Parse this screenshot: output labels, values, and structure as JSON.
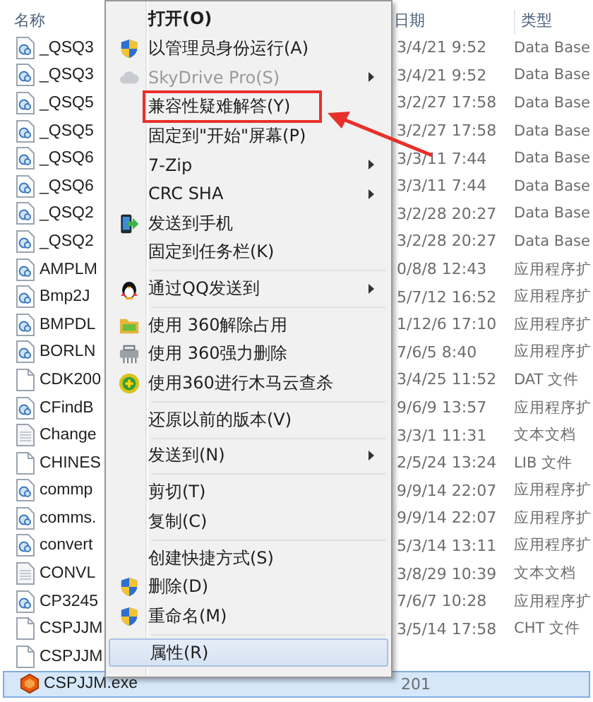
{
  "file_list": {
    "columns": [
      "名称",
      "日期",
      "类型"
    ],
    "rows": [
      {
        "name": "_QSQ3",
        "kind": "dll",
        "date": "3/4/21 9:52",
        "type": "Data Base",
        "selected": false
      },
      {
        "name": "_QSQ3",
        "kind": "dll",
        "date": "3/4/21 9:52",
        "type": "Data Base",
        "selected": false
      },
      {
        "name": "_QSQ5",
        "kind": "dll",
        "date": "3/2/27 17:58",
        "type": "Data Base",
        "selected": false
      },
      {
        "name": "_QSQ5",
        "kind": "dll",
        "date": "3/2/27 17:58",
        "type": "Data Base",
        "selected": false
      },
      {
        "name": "_QSQ6",
        "kind": "dll",
        "date": "3/3/11 7:44",
        "type": "Data Base",
        "selected": false
      },
      {
        "name": "_QSQ6",
        "kind": "dll",
        "date": "3/3/11 7:44",
        "type": "Data Base",
        "selected": false
      },
      {
        "name": "_QSQ2",
        "kind": "dll",
        "date": "3/2/28 20:27",
        "type": "Data Base",
        "selected": false
      },
      {
        "name": "_QSQ2",
        "kind": "dll",
        "date": "3/2/28 20:27",
        "type": "Data Base",
        "selected": false
      },
      {
        "name": "AMPLM",
        "kind": "dll",
        "date": "0/8/8 12:43",
        "type": "应用程序扩",
        "selected": false
      },
      {
        "name": "Bmp2J",
        "kind": "dll",
        "date": "5/7/12 16:52",
        "type": "应用程序扩",
        "selected": false
      },
      {
        "name": "BMPDL",
        "kind": "dll",
        "date": "1/12/6 17:10",
        "type": "应用程序扩",
        "selected": false
      },
      {
        "name": "BORLN",
        "kind": "dll",
        "date": "7/6/5 8:40",
        "type": "应用程序扩",
        "selected": false
      },
      {
        "name": "CDK200",
        "kind": "file",
        "date": "3/4/25 11:52",
        "type": "DAT 文件",
        "selected": false
      },
      {
        "name": "CFindB",
        "kind": "dll",
        "date": "9/6/9 13:57",
        "type": "应用程序扩",
        "selected": false
      },
      {
        "name": "Change",
        "kind": "text",
        "date": "3/3/1 11:31",
        "type": "文本文档",
        "selected": false
      },
      {
        "name": "CHINES",
        "kind": "file",
        "date": "2/5/24 13:24",
        "type": "LIB 文件",
        "selected": false
      },
      {
        "name": "commp",
        "kind": "dll",
        "date": "9/9/14 22:07",
        "type": "应用程序扩",
        "selected": false
      },
      {
        "name": "comms.",
        "kind": "dll",
        "date": "9/9/14 22:07",
        "type": "应用程序扩",
        "selected": false
      },
      {
        "name": "convert",
        "kind": "dll",
        "date": "5/3/14 13:11",
        "type": "应用程序扩",
        "selected": false
      },
      {
        "name": "CONVL",
        "kind": "text",
        "date": "3/8/29 10:39",
        "type": "文本文档",
        "selected": false
      },
      {
        "name": "CP3245",
        "kind": "dll",
        "date": "7/6/7 10:28",
        "type": "应用程序扩",
        "selected": false
      },
      {
        "name": "CSPJJM",
        "kind": "file",
        "date": "3/5/14 17:58",
        "type": "CHT 文件",
        "selected": false
      },
      {
        "name": "CSPJJM",
        "kind": "file",
        "selected": false
      },
      {
        "name": "CSPJJM.exe",
        "kind": "exe",
        "date": "201",
        "selected": true
      }
    ]
  },
  "context_menu": {
    "items": [
      {
        "kind": "plain",
        "label": "打开(O)",
        "bold": true,
        "submenu": false,
        "disabled": false,
        "selected": false,
        "annotated": false
      },
      {
        "kind": "shield",
        "label": "以管理员身份运行(A)",
        "bold": false,
        "submenu": false,
        "disabled": false,
        "selected": false,
        "annotated": false
      },
      {
        "kind": "cloud",
        "label": "SkyDrive Pro(S)",
        "bold": false,
        "submenu": true,
        "disabled": true,
        "selected": false,
        "annotated": false
      },
      {
        "kind": "plain",
        "label": "兼容性疑难解答(Y)",
        "bold": false,
        "submenu": false,
        "disabled": false,
        "selected": false,
        "annotated": true
      },
      {
        "kind": "plain",
        "label": "固定到\"开始\"屏幕(P)",
        "bold": false,
        "submenu": false,
        "disabled": false,
        "selected": false,
        "annotated": false
      },
      {
        "kind": "plain",
        "label": "7-Zip",
        "bold": false,
        "submenu": true,
        "disabled": false,
        "selected": false,
        "annotated": false
      },
      {
        "kind": "plain",
        "label": "CRC SHA",
        "bold": false,
        "submenu": true,
        "disabled": false,
        "selected": false,
        "annotated": false
      },
      {
        "kind": "phone",
        "label": "发送到手机",
        "bold": false,
        "submenu": false,
        "disabled": false,
        "selected": false,
        "annotated": false
      },
      {
        "kind": "plain",
        "label": "固定到任务栏(K)",
        "bold": false,
        "submenu": false,
        "disabled": false,
        "selected": false,
        "annotated": false
      },
      {
        "kind": "separator"
      },
      {
        "kind": "penguin",
        "label": "通过QQ发送到",
        "bold": false,
        "submenu": true,
        "disabled": false,
        "selected": false,
        "annotated": false
      },
      {
        "kind": "separator"
      },
      {
        "kind": "folder",
        "label": "使用 360解除占用",
        "bold": false,
        "submenu": false,
        "disabled": false,
        "selected": false,
        "annotated": false
      },
      {
        "kind": "shredder",
        "label": "使用 360强力删除",
        "bold": false,
        "submenu": false,
        "disabled": false,
        "selected": false,
        "annotated": false
      },
      {
        "kind": "plus",
        "label": "使用360进行木马云查杀",
        "bold": false,
        "submenu": false,
        "disabled": false,
        "selected": false,
        "annotated": false
      },
      {
        "kind": "separator"
      },
      {
        "kind": "plain",
        "label": "还原以前的版本(V)",
        "bold": false,
        "submenu": false,
        "disabled": false,
        "selected": false,
        "annotated": false
      },
      {
        "kind": "separator"
      },
      {
        "kind": "plain",
        "label": "发送到(N)",
        "bold": false,
        "submenu": true,
        "disabled": false,
        "selected": false,
        "annotated": false
      },
      {
        "kind": "separator"
      },
      {
        "kind": "plain",
        "label": "剪切(T)",
        "bold": false,
        "submenu": false,
        "disabled": false,
        "selected": false,
        "annotated": false
      },
      {
        "kind": "plain",
        "label": "复制(C)",
        "bold": false,
        "submenu": false,
        "disabled": false,
        "selected": false,
        "annotated": false
      },
      {
        "kind": "separator"
      },
      {
        "kind": "plain",
        "label": "创建快捷方式(S)",
        "bold": false,
        "submenu": false,
        "disabled": false,
        "selected": false,
        "annotated": false
      },
      {
        "kind": "shield",
        "label": "删除(D)",
        "bold": false,
        "submenu": false,
        "disabled": false,
        "selected": false,
        "annotated": false
      },
      {
        "kind": "shield",
        "label": "重命名(M)",
        "bold": false,
        "submenu": false,
        "disabled": false,
        "selected": false,
        "annotated": false
      },
      {
        "kind": "separator"
      },
      {
        "kind": "plain",
        "label": "属性(R)",
        "bold": false,
        "submenu": false,
        "disabled": false,
        "selected": true,
        "annotated": false
      }
    ]
  }
}
